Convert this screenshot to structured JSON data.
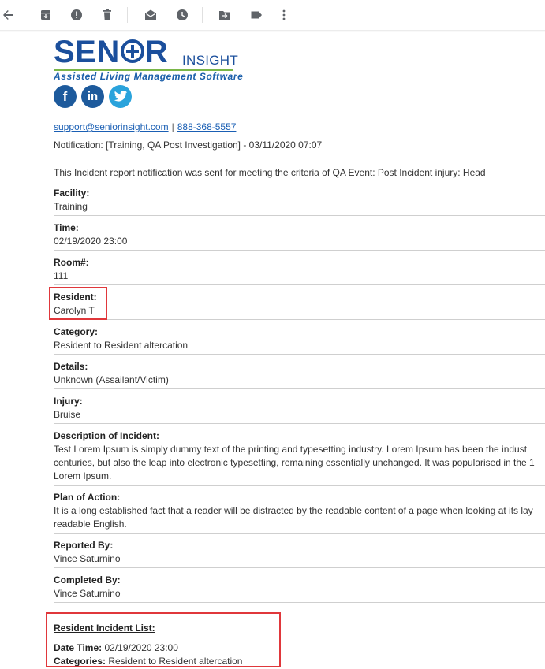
{
  "toolbar": {
    "icons": [
      "back-arrow-icon",
      "archive-icon",
      "report-spam-icon",
      "delete-icon",
      "mark-unread-icon",
      "snooze-icon",
      "move-to-icon",
      "label-icon",
      "more-icon"
    ]
  },
  "logo": {
    "wordmark_left": "SEN",
    "wordmark_right": "R",
    "wordmark_small": "INSIGHT",
    "tagline": "Assisted Living Management Software",
    "brand_color": "#1b4f9c",
    "accent_color": "#7ab648"
  },
  "social": {
    "facebook": "f",
    "linkedin": "in",
    "twitter": "twitter-bird-icon"
  },
  "contact": {
    "email": "support@seniorinsight.com",
    "separator": "|",
    "phone": "888-368-5557"
  },
  "notification": "Notification: [Training, QA Post Investigation] - 03/11/2020 07:07",
  "intro": "This Incident report notification was sent for meeting the criteria of QA Event: Post Incident injury: Head",
  "fields": [
    {
      "label": "Facility:",
      "value": "Training"
    },
    {
      "label": "Time:",
      "value": "02/19/2020 23:00"
    },
    {
      "label": "Room#:",
      "value": "111"
    },
    {
      "label": "Resident:",
      "value": "Carolyn T"
    },
    {
      "label": "Category:",
      "value": "Resident to Resident altercation"
    },
    {
      "label": "Details:",
      "value": "Unknown (Assailant/Victim)"
    },
    {
      "label": "Injury:",
      "value": "Bruise"
    },
    {
      "label": "Description of Incident:",
      "lines": [
        "Test Lorem Ipsum is simply dummy text of the printing and typesetting industry. Lorem Ipsum has been the indust",
        "centuries, but also the leap into electronic typesetting, remaining essentially unchanged. It was popularised in the 1",
        "Lorem Ipsum."
      ]
    },
    {
      "label": "Plan of Action:",
      "lines": [
        "It is a long established fact that a reader will be distracted by the readable content of a page when looking at its lay",
        "readable English."
      ]
    },
    {
      "label": "Reported By:",
      "value": "Vince Saturnino"
    },
    {
      "label": "Completed By:",
      "value": "Vince Saturnino"
    }
  ],
  "resident_incident_list": {
    "title": "Resident Incident List:",
    "date_time_label": "Date Time:",
    "date_time_value": "02/19/2020 23:00",
    "categories_label": "Categories:",
    "categories_value": "Resident to Resident altercation"
  },
  "highlight_color": "#e0373b"
}
